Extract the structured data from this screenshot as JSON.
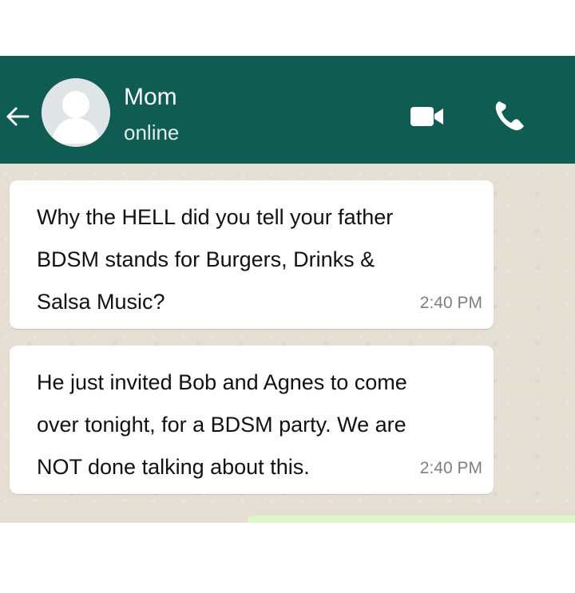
{
  "colors": {
    "header": "#0f5c52",
    "chat_background": "#e5ded3",
    "bubble": "#ffffff",
    "timestamp": "#7b8084"
  },
  "header": {
    "back_icon": "arrow-left-icon",
    "avatar_icon": "person-avatar-icon",
    "contact_name": "Mom",
    "status": "online",
    "video_icon": "video-camera-icon",
    "call_icon": "phone-icon"
  },
  "messages": [
    {
      "text": "Why the HELL did you tell your father\nBDSM stands for Burgers, Drinks &\nSalsa Music?",
      "time": "2:40 PM"
    },
    {
      "text": "He just invited Bob and Agnes to come\nover tonight, for a BDSM party. We are\nNOT done talking about this.",
      "time": "2:40 PM"
    }
  ]
}
